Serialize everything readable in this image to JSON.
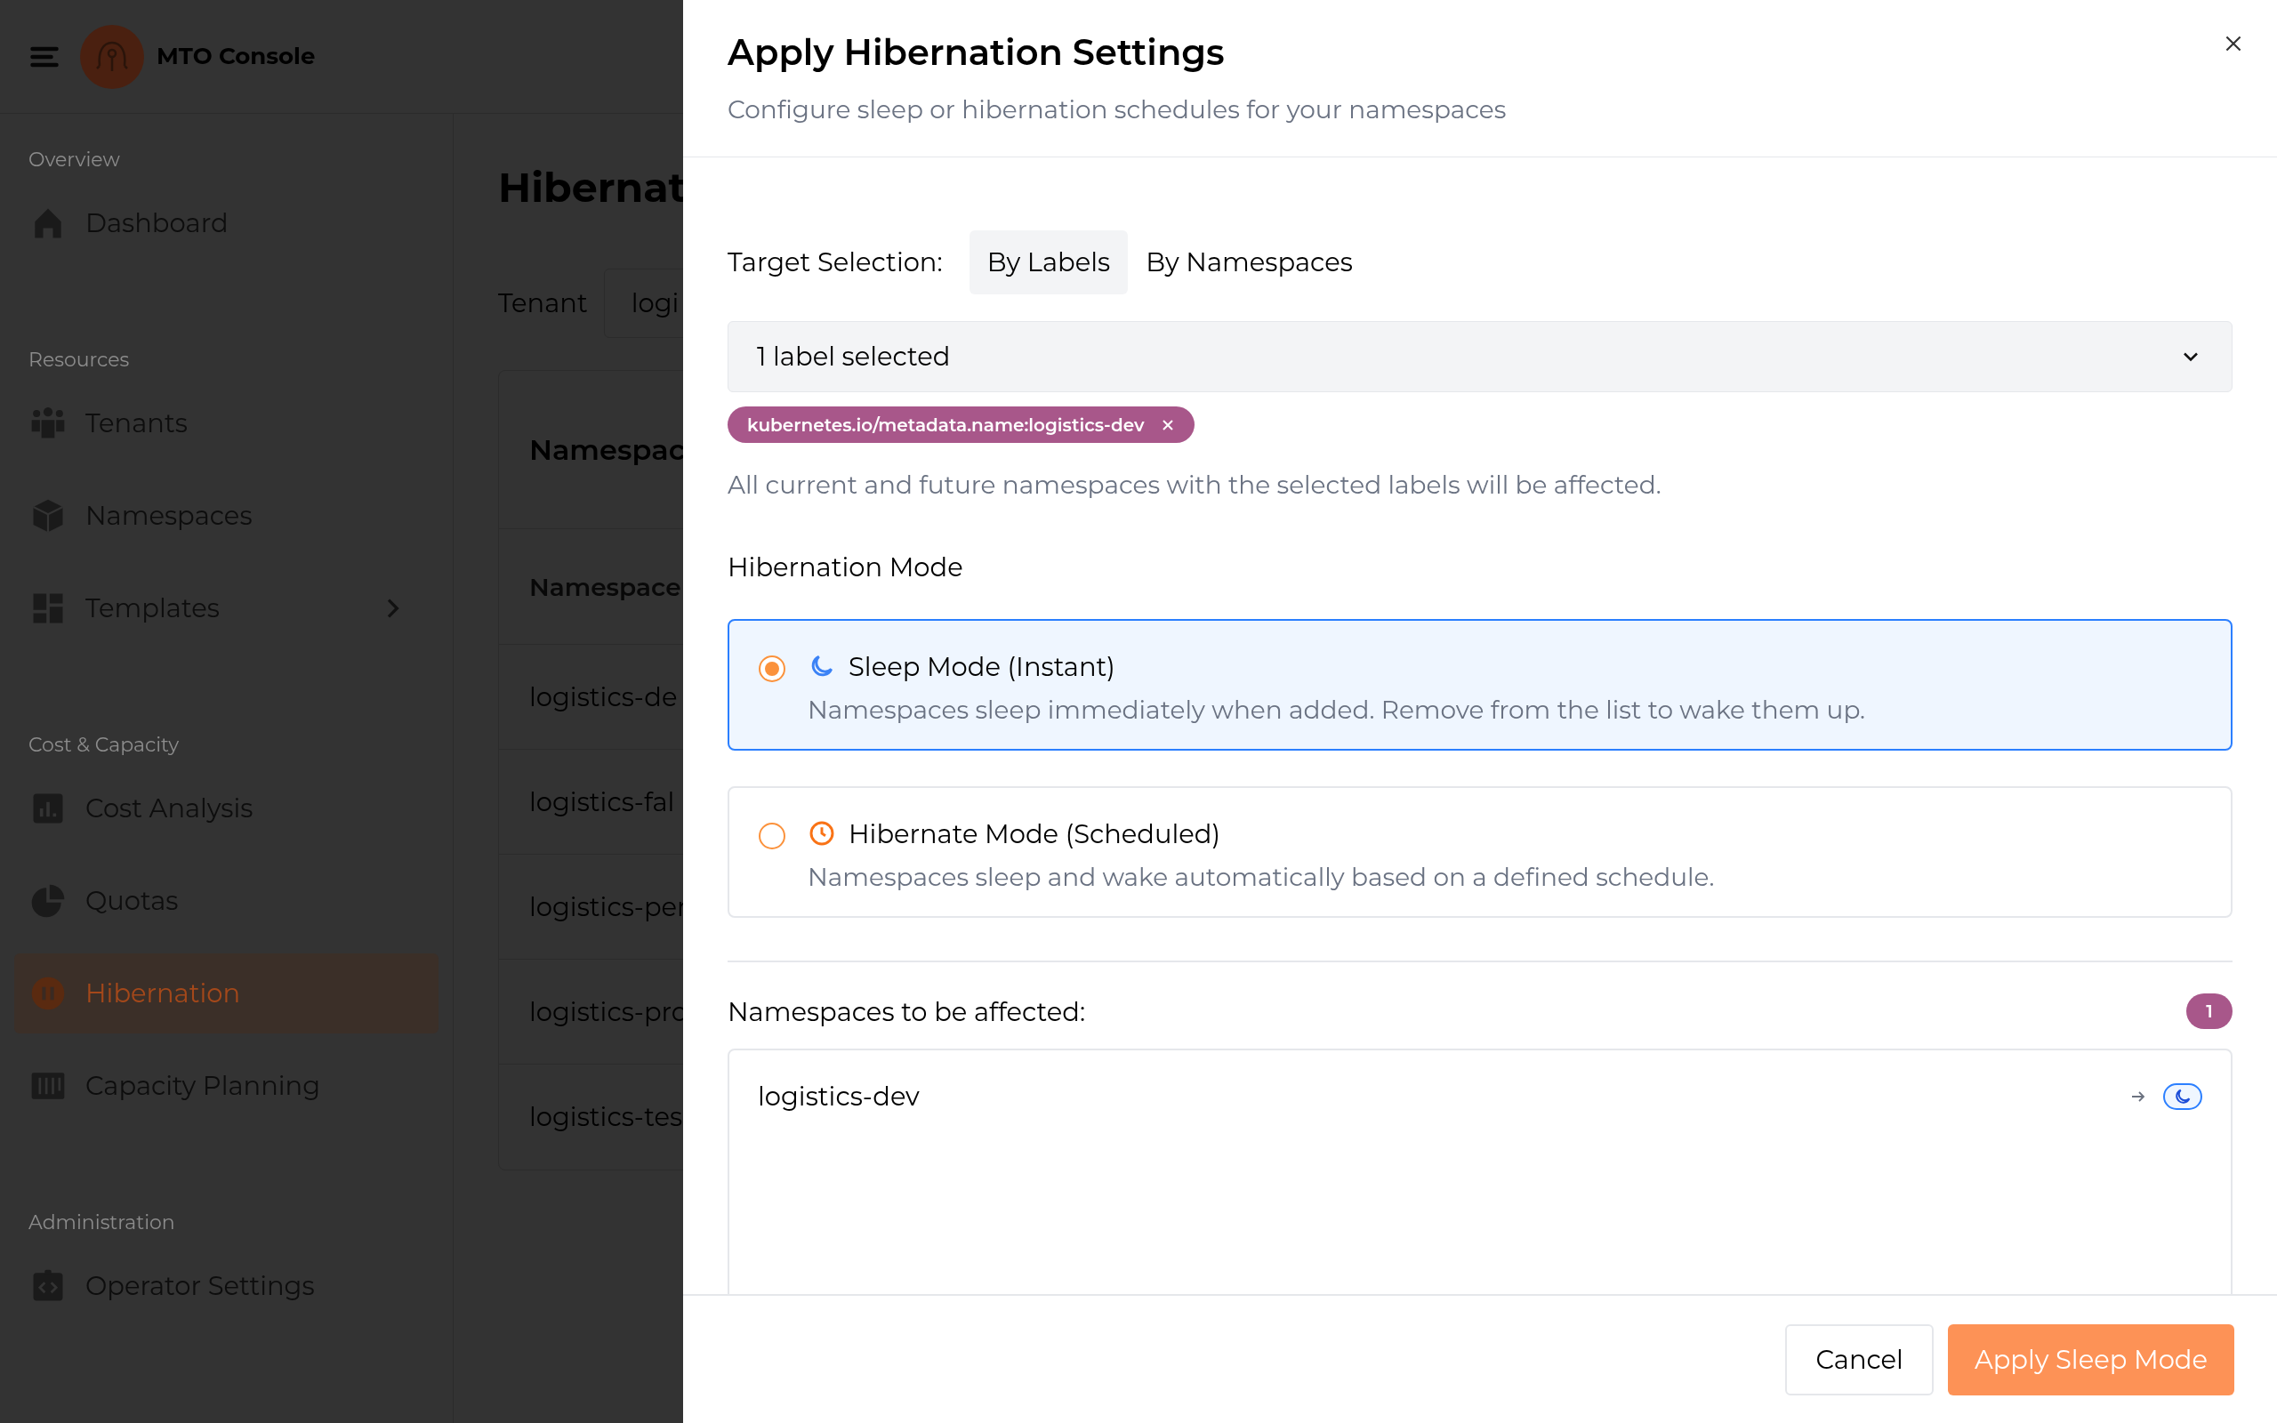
{
  "app": {
    "title": "MTO Console"
  },
  "sidebar": {
    "sections": [
      {
        "heading": "Overview",
        "items": [
          {
            "label": "Dashboard",
            "selected": false,
            "has_submenu": false
          }
        ]
      },
      {
        "heading": "Resources",
        "items": [
          {
            "label": "Tenants",
            "selected": false,
            "has_submenu": false
          },
          {
            "label": "Namespaces",
            "selected": false,
            "has_submenu": false
          },
          {
            "label": "Templates",
            "selected": false,
            "has_submenu": true
          }
        ]
      },
      {
        "heading": "Cost & Capacity",
        "items": [
          {
            "label": "Cost Analysis",
            "selected": false,
            "has_submenu": false
          },
          {
            "label": "Quotas",
            "selected": false,
            "has_submenu": false
          },
          {
            "label": "Hibernation",
            "selected": true,
            "has_submenu": false
          },
          {
            "label": "Capacity Planning",
            "selected": false,
            "has_submenu": false
          }
        ]
      },
      {
        "heading": "Administration",
        "items": [
          {
            "label": "Operator Settings",
            "selected": false,
            "has_submenu": false
          }
        ]
      }
    ]
  },
  "page": {
    "title": "Hibernat",
    "tenant_label": "Tenant",
    "tenant_value": "logi",
    "table": {
      "title": "Namespac",
      "column": "Namespace",
      "rows": [
        "logistics-de",
        "logistics-fal",
        "logistics-per",
        "logistics-pro",
        "logistics-tes"
      ]
    }
  },
  "dialog": {
    "title": "Apply Hibernation Settings",
    "subtitle": "Configure sleep or hibernation schedules for your namespaces",
    "target": {
      "label": "Target Selection:",
      "tabs": [
        {
          "label": "By Labels",
          "selected": true
        },
        {
          "label": "By Namespaces",
          "selected": false
        }
      ]
    },
    "dropdown": {
      "value": "1 label selected"
    },
    "tags": [
      {
        "label": "kubernetes.io/metadata.name:logistics-dev"
      }
    ],
    "help": "All current and future namespaces with the selected labels will be affected.",
    "mode": {
      "label": "Hibernation Mode",
      "options": [
        {
          "kind": "sleep",
          "title": "Sleep Mode (Instant)",
          "description": "Namespaces sleep immediately when added. Remove from the list to wake them up.",
          "selected": true
        },
        {
          "kind": "schedule",
          "title": "Hibernate Mode (Scheduled)",
          "description": "Namespaces sleep and wake automatically based on a defined schedule.",
          "selected": false
        }
      ]
    },
    "affected": {
      "label": "Namespaces to be affected:",
      "count": "1",
      "items": [
        {
          "name": "logistics-dev",
          "kind": "sleep"
        }
      ]
    },
    "buttons": {
      "cancel": "Cancel",
      "apply": "Apply Sleep Mode"
    }
  }
}
